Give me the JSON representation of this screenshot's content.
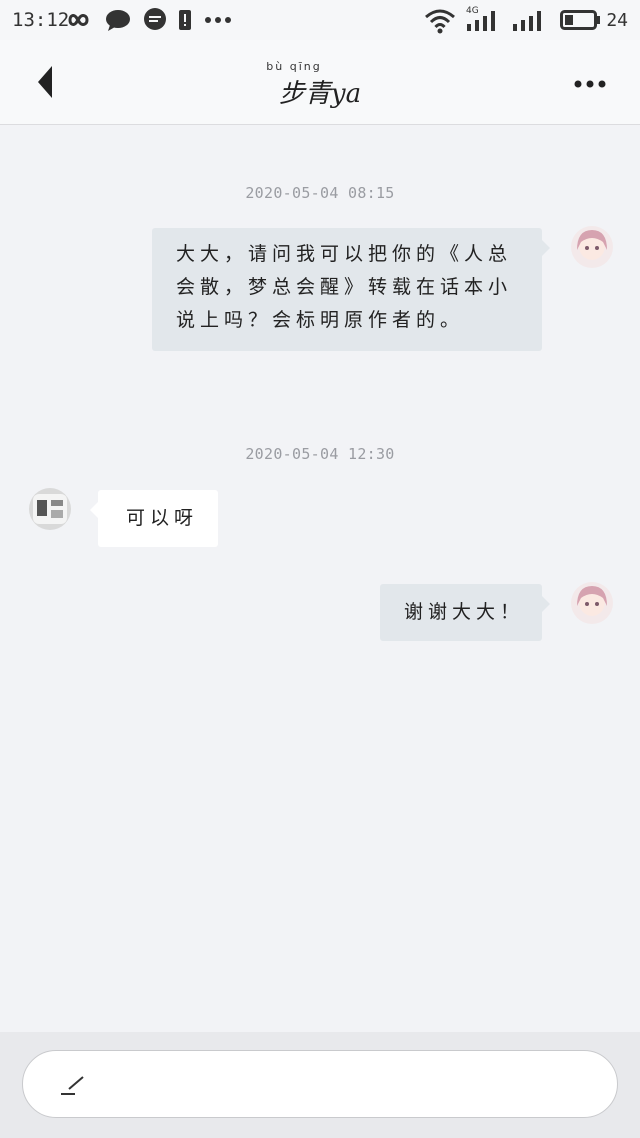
{
  "status_bar": {
    "time": "13:12",
    "network": "4G",
    "battery": "24",
    "icons": [
      "infinity-icon",
      "chat-bubble-icon",
      "message-icon",
      "battery-alert-icon",
      "more-dots-icon",
      "wifi-icon",
      "signal-icon",
      "battery-icon"
    ]
  },
  "header": {
    "title_pinyin": "bù qīng",
    "title": "步青ya",
    "back_icon": "back-arrow-icon",
    "more_icon": "more-icon"
  },
  "messages": [
    {
      "timestamp": "2020-05-04  08:15",
      "side": "right",
      "text": "大大，请问我可以把你的《人总会散，梦总会醒》转载在话本小说上吗？会标明原作者的。"
    },
    {
      "timestamp": "2020-05-04  12:30",
      "side": "left",
      "text": "可以呀"
    },
    {
      "side": "right",
      "text": "谢谢大大！"
    }
  ],
  "input": {
    "icon": "edit-icon"
  },
  "colors": {
    "background": "#f2f3f6",
    "bubble_self": "#e2e7eb",
    "bubble_other": "#ffffff",
    "timestamp": "#9a9ca2"
  }
}
